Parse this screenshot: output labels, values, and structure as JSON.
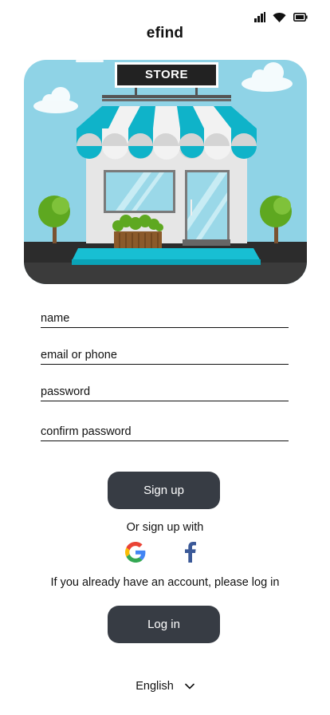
{
  "status_bar": {
    "icons": [
      "cellular-signal-icon",
      "wifi-icon",
      "battery-icon"
    ]
  },
  "app": {
    "title": "efind"
  },
  "hero": {
    "store_sign": "STORE",
    "colors": {
      "sky": "#8fd3e6",
      "awning_teal": "#0fb3c9",
      "awning_white": "#f2f2f2",
      "wall": "#e6e6e6",
      "ground": "#3b3b3b",
      "tree": "#5ea820",
      "trunk": "#7a5230"
    }
  },
  "form": {
    "name_placeholder": "name",
    "email_placeholder": "email or phone",
    "password_placeholder": "password",
    "confirm_placeholder": "confirm password"
  },
  "actions": {
    "signup_label": "Sign up",
    "alt_signup_text": "Or sign up with",
    "login_prompt": "If you already have an account, please log in",
    "login_label": "Log in"
  },
  "social": {
    "providers": [
      "google-icon",
      "facebook-icon"
    ]
  },
  "language": {
    "selected": "English"
  },
  "colors": {
    "button_bg": "#373c44",
    "button_text": "#ffffff",
    "facebook_blue": "#3b5998"
  }
}
